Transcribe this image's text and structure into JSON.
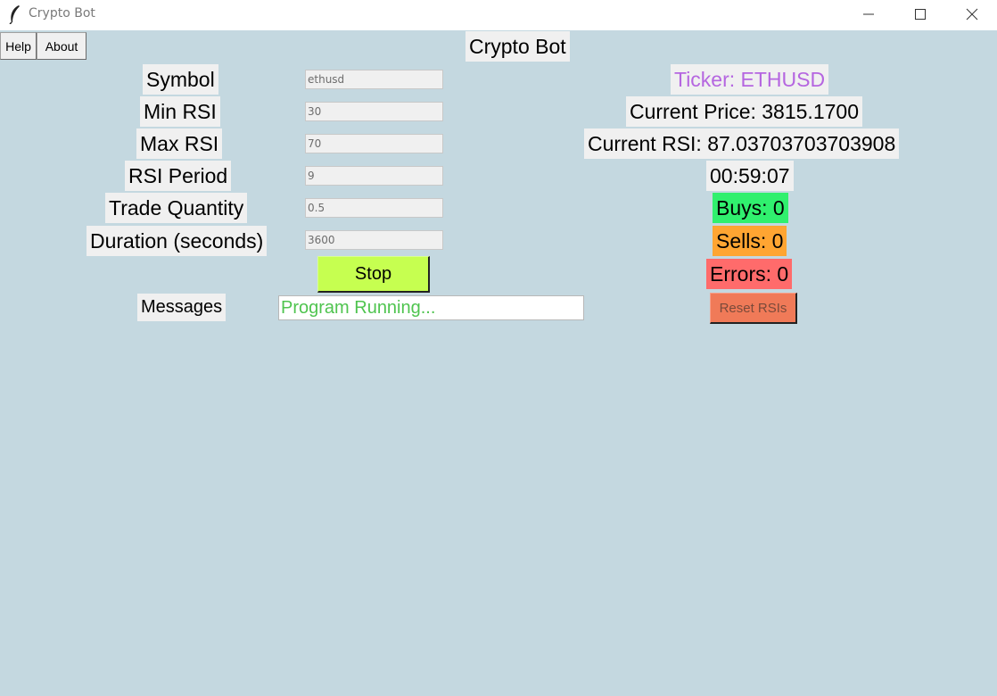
{
  "window": {
    "title": "Crypto Bot"
  },
  "menu": {
    "help": "Help",
    "about": "About"
  },
  "header": {
    "title": "Crypto Bot"
  },
  "form": {
    "fields": [
      {
        "label": "Symbol",
        "value": "ethusd"
      },
      {
        "label": "Min RSI",
        "value": "30"
      },
      {
        "label": "Max RSI",
        "value": "70"
      },
      {
        "label": "RSI Period",
        "value": "9"
      },
      {
        "label": "Trade Quantity",
        "value": "0.5"
      },
      {
        "label": "Duration (seconds)",
        "value": "3600"
      }
    ],
    "stop_label": "Stop",
    "messages_label": "Messages",
    "messages_value": "Program Running..."
  },
  "status": {
    "ticker": "Ticker: ETHUSD",
    "price": "Current Price: 3815.1700",
    "rsi": "Current RSI: 87.03703703703908",
    "timer": "00:59:07",
    "buys": "Buys: 0",
    "sells": "Sells: 0",
    "errors": "Errors: 0",
    "reset_label": "Reset RSIs"
  },
  "colors": {
    "background": "#c4d8e0",
    "ticker_text": "#b566e0",
    "buys_bg": "#30f06e",
    "sells_bg": "#ffa532",
    "errors_bg": "#ff6b6b",
    "stop_bg": "#c6ff50",
    "reset_bg": "#f07a58",
    "messages_text": "#4fc44f"
  }
}
